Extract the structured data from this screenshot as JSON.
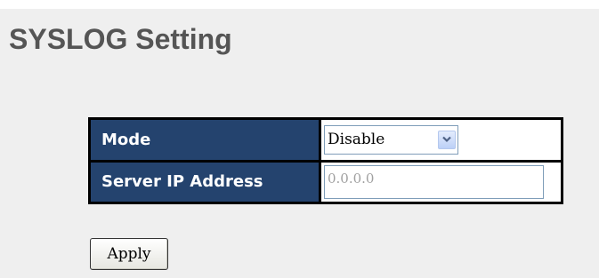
{
  "page": {
    "title": "SYSLOG Setting"
  },
  "form": {
    "mode_label": "Mode",
    "mode_value": "Disable",
    "server_ip_label": "Server IP Address",
    "server_ip_value": "0.0.0.0"
  },
  "actions": {
    "apply_label": "Apply"
  },
  "icons": {
    "dropdown": "chevron-down-icon"
  },
  "colors": {
    "header_cell_bg": "#24436e",
    "title_text": "#555555",
    "panel_bg": "#efefef"
  }
}
